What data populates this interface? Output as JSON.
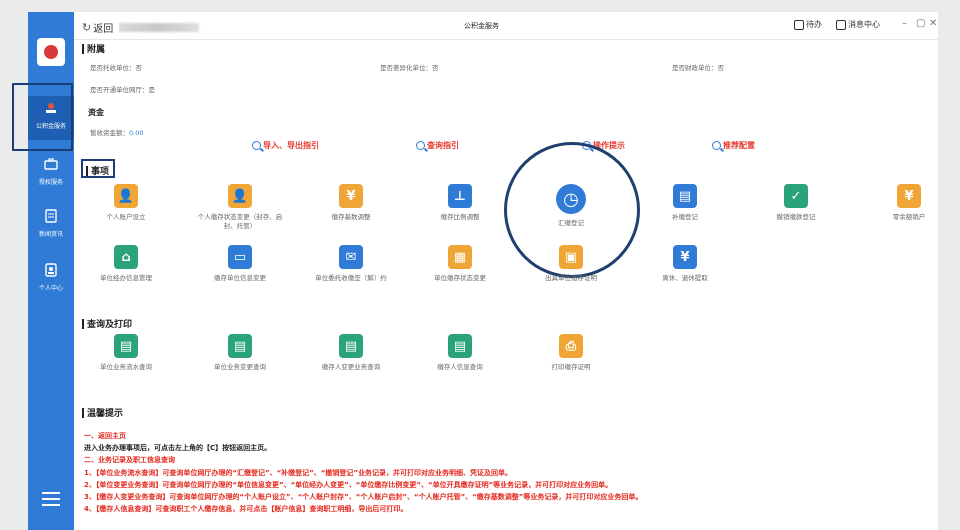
{
  "window": {
    "back_label": "返回",
    "title": "公积金服务",
    "todo_label": "待办",
    "message_label": "消息中心",
    "controls": [
      "–",
      "▢",
      "✕"
    ]
  },
  "sidebar": {
    "items": [
      {
        "label": "公积金服务",
        "icon": "building-icon",
        "active": true
      },
      {
        "label": "授权服务",
        "icon": "briefcase-icon",
        "active": false
      },
      {
        "label": "新闻资讯",
        "icon": "document-icon",
        "active": false
      },
      {
        "label": "个人中心",
        "icon": "user-icon",
        "active": false
      }
    ]
  },
  "attach": {
    "heading": "附属",
    "fields": [
      {
        "text": "是否托收单位：否"
      },
      {
        "text": "是否差异化单位：否"
      },
      {
        "text": "是否财政单位：否"
      },
      {
        "text": "是否开通单位网厅：是"
      }
    ]
  },
  "funds": {
    "heading": "资金",
    "label": "暂收资金额：",
    "value": "0.00"
  },
  "quick_links": [
    {
      "label": "导入、导出指引"
    },
    {
      "label": "查询指引"
    },
    {
      "label": "操作提示"
    },
    {
      "label": "推荐配置"
    }
  ],
  "matters": {
    "heading": "事项",
    "row1": [
      {
        "label": "个人账户设立",
        "icon": "person-add-icon",
        "color": "#f0a637"
      },
      {
        "label": "个人缴存状态变更（封存、启封、托管）",
        "icon": "person-gear-icon",
        "color": "#f0a637"
      },
      {
        "label": "缴存基数调整",
        "icon": "yen-badge-icon",
        "color": "#f0a637"
      },
      {
        "label": "缴存比例调整",
        "icon": "stamp-icon",
        "color": "#2f7bd6"
      },
      {
        "label": "汇缴登记",
        "icon": "clock-icon",
        "color": "#2f7bd6"
      },
      {
        "label": "补缴登记",
        "icon": "id-card-icon",
        "color": "#2f7bd6"
      },
      {
        "label": "撤销缴款登记",
        "icon": "shield-icon",
        "color": "#2aa37a"
      },
      {
        "label": "零余额销户",
        "icon": "yen-badge-icon",
        "color": "#f0a637"
      }
    ],
    "row2": [
      {
        "label": "单位经办信息管理",
        "icon": "house-icon",
        "color": "#2aa37a"
      },
      {
        "label": "缴存单位信息变更",
        "icon": "car-icon",
        "color": "#2f7bd6"
      },
      {
        "label": "单位委托收缴签（解）约",
        "icon": "envelope-icon",
        "color": "#2f7bd6"
      },
      {
        "label": "单位缴存状态变更",
        "icon": "building-status-icon",
        "color": "#f0a637"
      },
      {
        "label": "出具单位缴存证明",
        "icon": "certificate-icon",
        "color": "#f0a637"
      },
      {
        "label": "离休、退休提取",
        "icon": "coin-icon",
        "color": "#2f7bd6"
      }
    ]
  },
  "query": {
    "heading": "查询及打印",
    "items": [
      {
        "label": "单位业务流水查询",
        "icon": "doc-search-icon",
        "color": "#2aa37a"
      },
      {
        "label": "单位业务变更查询",
        "icon": "doc-search-icon",
        "color": "#2aa37a"
      },
      {
        "label": "缴存人变更业务查询",
        "icon": "doc-search-icon",
        "color": "#2aa37a"
      },
      {
        "label": "缴存人信息查询",
        "icon": "doc-search-icon",
        "color": "#2aa37a"
      },
      {
        "label": "打印缴存证明",
        "icon": "printer-icon",
        "color": "#f0a637"
      }
    ]
  },
  "tips": {
    "heading": "温馨提示",
    "lines": [
      {
        "text": "一、返回主页",
        "style": "red"
      },
      {
        "text": "进入业务办理事项后，可点击左上角的【C】按钮返回主页。",
        "style": "dark"
      },
      {
        "text": "二、业务记录及职工信息查询",
        "style": "red"
      },
      {
        "text": "1、【单位业务流水查询】可查询单位网厅办理的“汇缴登记”、“补缴登记”、“撤销登记”业务记录，并可打印对应业务明细、凭证及回单。",
        "style": "red"
      },
      {
        "text": "2、【单位变更业务查询】可查询单位网厅办理的“单位信息变更”、“单位经办人变更”、“单位缴存比例变更”、“单位开具缴存证明”等业务记录，并可打印对应业务回单。",
        "style": "red"
      },
      {
        "text": "3、【缴存人变更业务查询】可查询单位网厅办理的“个人账户设立”、“个人账户封存”、“个人账户启封”、“个人账户托管”、“缴存基数调整”等业务记录，并可打印对应业务回单。",
        "style": "red"
      },
      {
        "text": "4、【缴存人信息查询】可查询职工个人缴存信息，并可点击【账户信息】查询职工明细，导出后可打印。",
        "style": "red"
      }
    ]
  }
}
